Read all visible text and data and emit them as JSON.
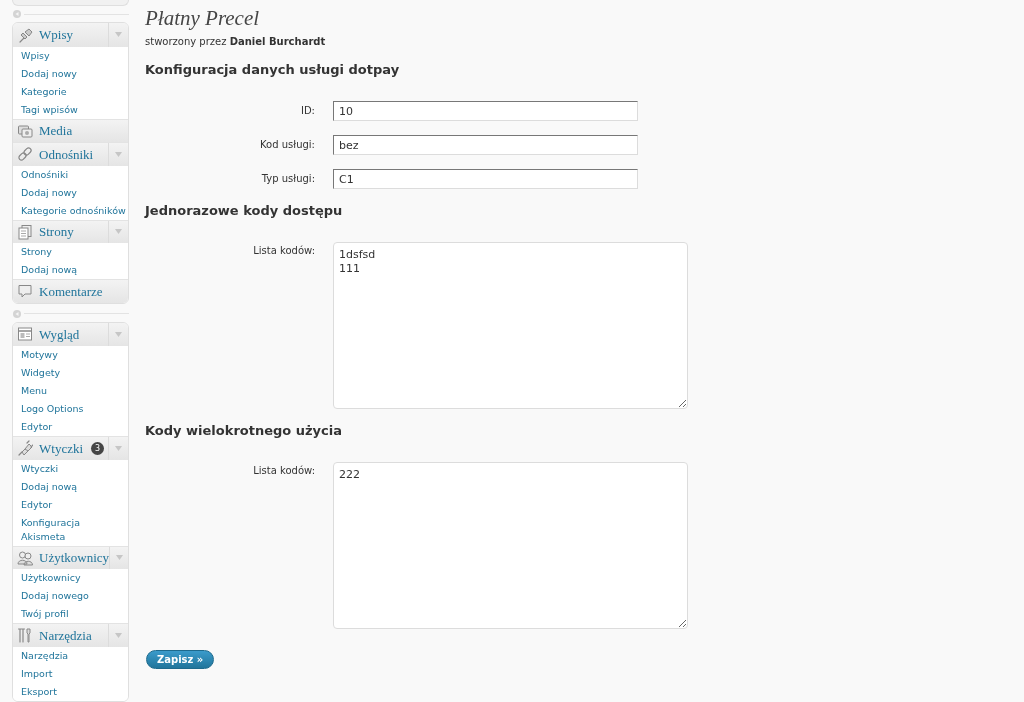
{
  "sidebar": {
    "groups": [
      {
        "menus": [
          {
            "label": "Wpisy",
            "items": [
              "Wpisy",
              "Dodaj nowy",
              "Kategorie",
              "Tagi wpisów"
            ]
          },
          {
            "label": "Media"
          },
          {
            "label": "Odnośniki",
            "items": [
              "Odnośniki",
              "Dodaj nowy",
              "Kategorie odnośników"
            ]
          },
          {
            "label": "Strony",
            "items": [
              "Strony",
              "Dodaj nową"
            ]
          },
          {
            "label": "Komentarze"
          }
        ]
      },
      {
        "menus": [
          {
            "label": "Wygląd",
            "items": [
              "Motywy",
              "Widgety",
              "Menu",
              "Logo Options",
              "Edytor"
            ]
          },
          {
            "label": "Wtyczki",
            "badge": "3",
            "items": [
              "Wtyczki",
              "Dodaj nową",
              "Edytor",
              "Konfiguracja Akismeta"
            ]
          },
          {
            "label": "Użytkownicy",
            "items": [
              "Użytkownicy",
              "Dodaj nowego",
              "Twój profil"
            ]
          },
          {
            "label": "Narzędzia",
            "items": [
              "Narzędzia",
              "Import",
              "Eksport"
            ]
          }
        ]
      }
    ]
  },
  "page": {
    "title": "Płatny Precel",
    "byline": "stworzony przez **Daniel Burchardt**"
  },
  "sections": [
    {
      "heading": "Konfiguracja danych usługi dotpay",
      "fields": [
        {
          "kind": "input",
          "label": "ID:",
          "value": "10"
        },
        {
          "kind": "input",
          "label": "Kod usługi:",
          "value": "bez"
        },
        {
          "kind": "input",
          "label": "Typ usługi:",
          "value": "C1"
        }
      ]
    },
    {
      "heading": "Jednorazowe kody dostępu",
      "fields": [
        {
          "kind": "textarea",
          "label": "Lista kodów:",
          "value": "1dsfsd\n111"
        }
      ]
    },
    {
      "heading": "Kody wielokrotnego użycia",
      "fields": [
        {
          "kind": "textarea",
          "label": "Lista kodów:",
          "value": "222"
        }
      ]
    }
  ],
  "save_button": "Zapisz »"
}
